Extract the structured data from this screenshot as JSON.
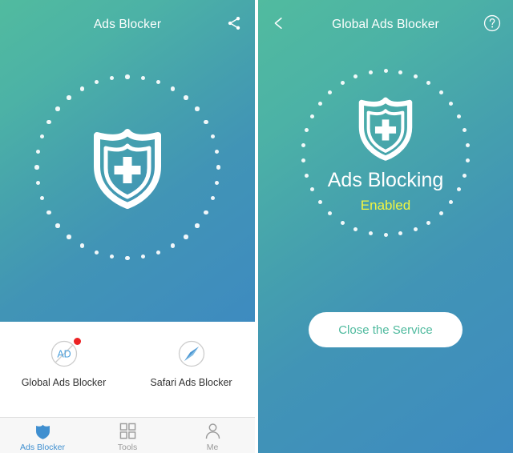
{
  "colors": {
    "gradient_start": "#51bb9f",
    "gradient_mid": "#45a0ae",
    "gradient_end": "#3e8bc0",
    "enabled_text": "#f2f540",
    "button_text": "#4fba9e",
    "accent_blue": "#3f8fd0",
    "badge_red": "#ec2224",
    "white": "#ffffff",
    "tabbar_bg": "#f7f7f7",
    "inactive_tab": "#9a9a9a"
  },
  "left_screen": {
    "header": {
      "title": "Ads Blocker",
      "share_icon": "share-icon"
    },
    "hero": {
      "shield_icon": "shield-check-icon",
      "dotted_ring": "dotted-circle-decoration"
    },
    "shortcuts": [
      {
        "label": "Global Ads Blocker",
        "icon": "ad-block-icon",
        "icon_text": "AD",
        "badge": true
      },
      {
        "label": "Safari Ads Blocker",
        "icon": "safari-compass-icon",
        "badge": false
      }
    ],
    "tabbar": [
      {
        "label": "Ads Blocker",
        "icon": "shield-icon",
        "active": true
      },
      {
        "label": "Tools",
        "icon": "grid-icon",
        "active": false
      },
      {
        "label": "Me",
        "icon": "person-icon",
        "active": false
      }
    ]
  },
  "right_screen": {
    "header": {
      "title": "Global Ads Blocker",
      "back_icon": "chevron-left-icon",
      "help_icon": "question-mark-circle-icon"
    },
    "hero": {
      "shield_icon": "shield-check-icon",
      "dotted_ring": "dotted-circle-decoration"
    },
    "status": {
      "title": "Ads Blocking",
      "state": "Enabled"
    },
    "action": {
      "close_service_label": "Close the Service"
    }
  }
}
